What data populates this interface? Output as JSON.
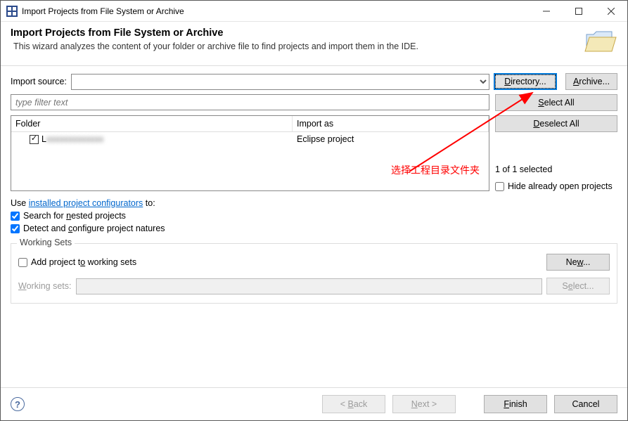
{
  "titlebar": {
    "title": "Import Projects from File System or Archive"
  },
  "header": {
    "title": "Import Projects from File System or Archive",
    "desc": "This wizard analyzes the content of your folder or archive file to find projects and import them in the IDE."
  },
  "importSource": {
    "label": "Import source:",
    "value": ""
  },
  "buttons": {
    "directory": "Directory...",
    "archive": "Archive...",
    "selectAll": "Select All",
    "deselectAll": "Deselect All",
    "new": "New...",
    "select": "Select...",
    "back": "< Back",
    "next": "Next >",
    "finish": "Finish",
    "cancel": "Cancel"
  },
  "filter": {
    "placeholder": "type filter text"
  },
  "table": {
    "headers": {
      "folder": "Folder",
      "import": "Import as"
    },
    "rows": [
      {
        "checked": true,
        "folder": "L",
        "importAs": "Eclipse project"
      }
    ]
  },
  "selection": {
    "status": "1 of 1 selected",
    "hideOpen": "Hide already open projects"
  },
  "configurators": {
    "prefix": "Use ",
    "link": "installed project configurators",
    "suffix": " to:"
  },
  "options": {
    "searchNested": "Search for nested projects",
    "detectConfigure": "Detect and configure project natures"
  },
  "workingSets": {
    "group": "Working Sets",
    "add": "Add project to working sets",
    "label": "Working sets:"
  },
  "annotation": {
    "text": "选择工程目录文件夹"
  },
  "underlines": {
    "directory": "D",
    "archive": "A",
    "selectAll": "S",
    "deselectAll": "D",
    "nested": "n",
    "configure": "c",
    "workingSetsAdd": "o",
    "workingSetsLabel": "W",
    "new": "w",
    "select": "e",
    "back": "B",
    "next": "N",
    "finish": "F"
  }
}
